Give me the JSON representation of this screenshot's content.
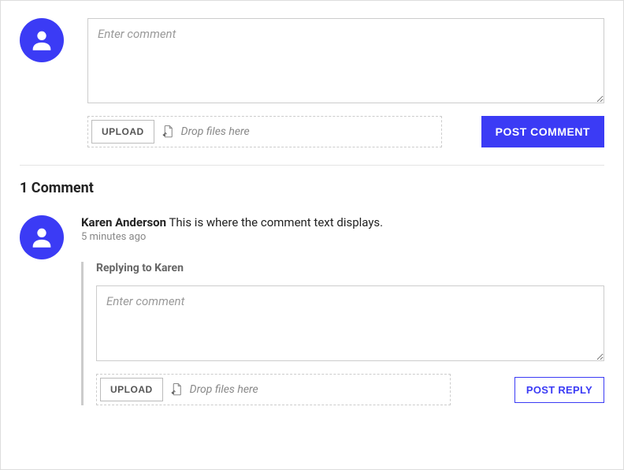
{
  "entry": {
    "placeholder": "Enter comment",
    "upload_label": "UPLOAD",
    "drop_hint": "Drop files here",
    "post_label": "POST COMMENT"
  },
  "comments_heading": "1 Comment",
  "comment": {
    "author": "Karen Anderson",
    "text": "This is where the comment text displays.",
    "time": "5 minutes ago"
  },
  "reply": {
    "heading": "Replying to Karen",
    "placeholder": "Enter comment",
    "upload_label": "UPLOAD",
    "drop_hint": "Drop files here",
    "post_label": "POST REPLY"
  }
}
